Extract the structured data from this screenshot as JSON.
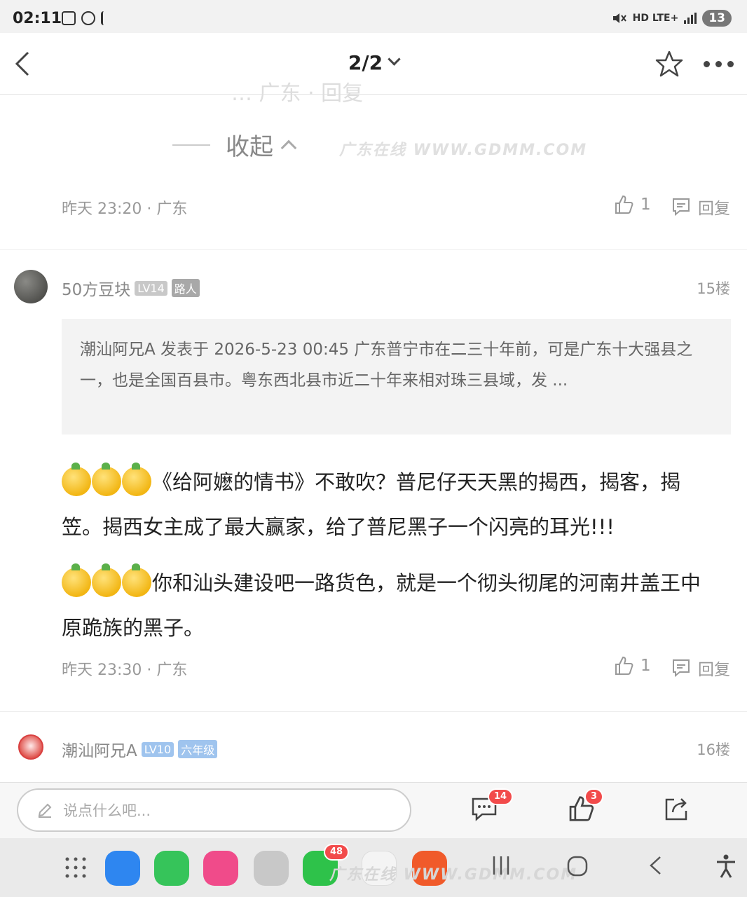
{
  "status_bar": {
    "time": "02:11",
    "network": "HD LTE+",
    "battery": "13"
  },
  "header": {
    "title": "2/2"
  },
  "prev_comment": {
    "ghost_text": "…   广东  · 回复",
    "collapse_label": "收起",
    "watermark": "广东在线 WWW.GDMM.COM",
    "time_loc": "昨天 23:20 · 广东",
    "likes": "1",
    "reply": "回复"
  },
  "comment": {
    "username": "50方豆块",
    "level": "LV14",
    "role": "路人",
    "floor": "15楼",
    "quote": "潮汕阿兄A 发表于 2026-5-23 00:45 广东普宁市在二三十年前，可是广东十大强县之一，也是全国百县市。粤东西北县市近二十年来相对珠三县域，发 ...",
    "para1": "《给阿嬷的情书》不敢吹？普尼仔天天黑的揭西，揭客，揭笠。揭西女主成了最大赢家，给了普尼黑子一个闪亮的耳光!!!",
    "para2": "你和汕头建设吧一路货色，就是一个彻头彻尾的河南井盖王中原跪族的黑子。",
    "time_loc": "昨天 23:30 · 广东",
    "likes": "1",
    "reply": "回复"
  },
  "next_comment": {
    "username": "潮汕阿兄A",
    "level": "LV10",
    "role": "六年级",
    "floor": "16楼"
  },
  "input_bar": {
    "placeholder": "说点什么吧...",
    "comment_count": "14",
    "like_count": "3"
  },
  "nav": {
    "wechat_badge": "48",
    "watermark": "广东在线 WWW.GDMM.COM"
  },
  "colors": {
    "accent_red": "#f24b4b",
    "tag_blue": "#9fc4ee",
    "tag_gray": "#c8c8c8"
  }
}
